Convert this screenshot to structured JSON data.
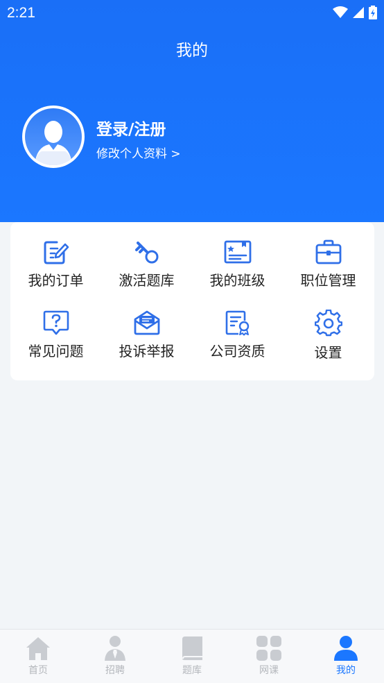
{
  "status_bar": {
    "time": "2:21"
  },
  "header": {
    "title": "我的"
  },
  "user": {
    "name": "登录/注册",
    "edit_link": "修改个人资料 >"
  },
  "menu": [
    {
      "label": "我的订单",
      "icon": "edit-icon"
    },
    {
      "label": "激活题库",
      "icon": "key-icon"
    },
    {
      "label": "我的班级",
      "icon": "class-card-icon"
    },
    {
      "label": "职位管理",
      "icon": "briefcase-icon"
    },
    {
      "label": "常见问题",
      "icon": "question-icon"
    },
    {
      "label": "投诉举报",
      "icon": "mail-icon"
    },
    {
      "label": "公司资质",
      "icon": "certificate-icon"
    },
    {
      "label": "设置",
      "icon": "gear-icon"
    }
  ],
  "tabs": [
    {
      "label": "首页",
      "icon": "home-icon",
      "active": false
    },
    {
      "label": "招聘",
      "icon": "recruit-icon",
      "active": false
    },
    {
      "label": "题库",
      "icon": "book-icon",
      "active": false
    },
    {
      "label": "网课",
      "icon": "grid-icon",
      "active": false
    },
    {
      "label": "我的",
      "icon": "user-icon",
      "active": true
    }
  ],
  "colors": {
    "primary": "#1b77ff",
    "icon_blue": "#2f6fe8",
    "tab_inactive": "#c9ccd1"
  }
}
